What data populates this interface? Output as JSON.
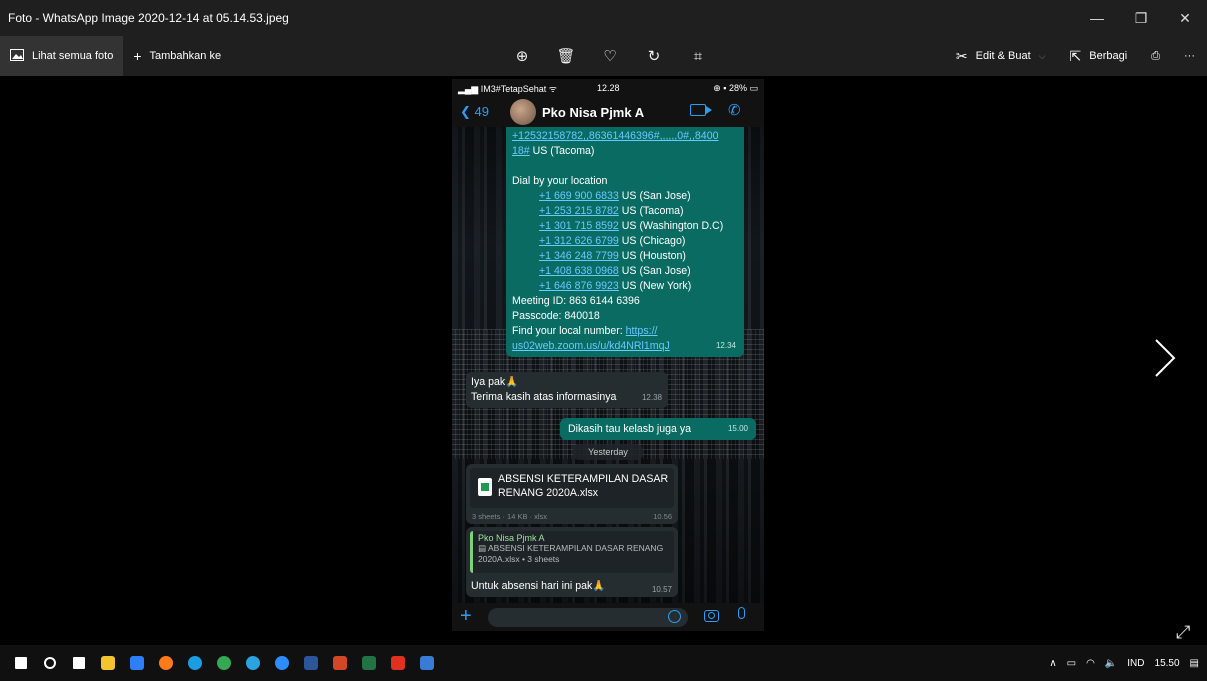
{
  "window": {
    "title": "Foto - WhatsApp Image 2020-12-14 at 05.14.53.jpeg",
    "controls": {
      "minimize": "—",
      "restore": "❐",
      "close": "✕"
    }
  },
  "toolbar": {
    "see_all_label": "Lihat semua foto",
    "add_to_label": "Tambahkan ke",
    "center_icons": [
      "zoom-in-icon",
      "delete-icon",
      "favorite-icon",
      "rotate-icon",
      "crop-icon"
    ],
    "edit_create_label": "Edit & Buat",
    "share_label": "Berbagi",
    "more_label": "···"
  },
  "phone": {
    "status": {
      "carrier": "IM3#TetapSehat",
      "time": "12.28",
      "battery": "28%"
    },
    "chat": {
      "back_count": "49",
      "contact_name": "Pko Nisa Pjmk A"
    },
    "zoom_message": {
      "top_link_1": "+12532158782,,86361446396#,,,,,,0#,,8400",
      "top_link_2": "18#",
      "top_loc": "US (Tacoma)",
      "dial_heading": "Dial by your location",
      "numbers": [
        {
          "number": "+1 669 900 6833",
          "loc": "US (San Jose)"
        },
        {
          "number": "+1 253 215 8782",
          "loc": "US (Tacoma)"
        },
        {
          "number": "+1 301 715 8592",
          "loc": "US (Washington D.C)"
        },
        {
          "number": "+1 312 626 6799",
          "loc": "US (Chicago)"
        },
        {
          "number": "+1 346 248 7799",
          "loc": "US (Houston)"
        },
        {
          "number": "+1 408 638 0968",
          "loc": "US (San Jose)"
        },
        {
          "number": "+1 646 876 9923",
          "loc": "US (New York)"
        }
      ],
      "meeting_id": "Meeting ID: 863 6144 6396",
      "passcode": "Passcode: 840018",
      "find_local": "Find your local number:",
      "find_link_1": "https://",
      "find_link_2": "us02web.zoom.us/u/kd4NRl1mqJ",
      "time": "12.34"
    },
    "reply_1": {
      "line1": "Iya pak🙏",
      "line2": "Terima kasih atas informasinya",
      "time": "12.38"
    },
    "sent_2": {
      "text": "Dikasih tau kelasb juga ya",
      "time": "15.00"
    },
    "day_separator": "Yesterday",
    "file_message": {
      "filename": "ABSENSI KETERAMPILAN DASAR RENANG 2020A.xlsx",
      "meta": "3 sheets · 14 KB · xlsx",
      "time": "10.56"
    },
    "reply_message": {
      "quoted_name": "Pko Nisa Pjmk A",
      "quoted_text": "ABSENSI KETERAMPILAN DASAR RENANG 2020A.xlsx • 3 sheets",
      "body": "Untuk absensi hari ini pak🙏",
      "time": "10.57"
    }
  },
  "taskbar": {
    "apps": [
      "windows-start",
      "search",
      "task-view",
      "file-explorer",
      "store",
      "firefox",
      "edge",
      "chrome",
      "telegram",
      "zoom",
      "word",
      "powerpoint",
      "excel",
      "acrobat",
      "photos"
    ],
    "app_colors": [
      "#ffffff",
      "#ffffff",
      "#ffffff",
      "#f4c430",
      "#2d7ff9",
      "#ff7a1a",
      "#1b9de2",
      "#34a853",
      "#2aa3e0",
      "#2d8cff",
      "#2b579a",
      "#d24726",
      "#217346",
      "#e0301e",
      "#3a7bd5"
    ],
    "tray": {
      "language": "IND",
      "time": "15.50"
    }
  }
}
